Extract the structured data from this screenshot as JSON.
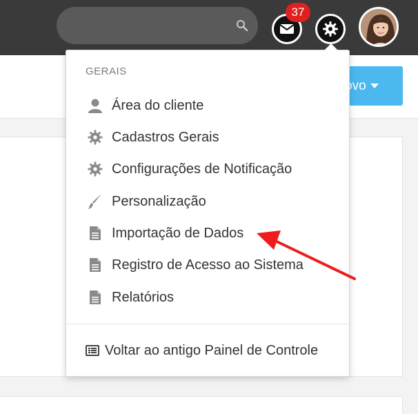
{
  "topbar": {
    "search": {
      "placeholder": ""
    },
    "mail": {
      "icon": "mail-icon",
      "unread_count": "37"
    },
    "settings": {
      "icon": "gear-icon"
    },
    "avatar": {
      "icon": "user-avatar"
    }
  },
  "page": {
    "new_button_label": "ovo"
  },
  "dropdown": {
    "section_label": "GERAIS",
    "items": [
      {
        "label": "Área do cliente",
        "icon": "user-icon"
      },
      {
        "label": "Cadastros Gerais",
        "icon": "gear-icon"
      },
      {
        "label": "Configurações de Notificação",
        "icon": "gear-icon"
      },
      {
        "label": "Personalização",
        "icon": "brush-icon"
      },
      {
        "label": "Importação de Dados",
        "icon": "document-icon"
      },
      {
        "label": "Registro de Acesso ao Sistema",
        "icon": "document-icon"
      },
      {
        "label": "Relatórios",
        "icon": "document-icon"
      }
    ],
    "footer_label": "Voltar ao antigo Painel de Controle",
    "footer_icon": "panel-icon"
  },
  "colors": {
    "topbar": "#3a3a3a",
    "badge": "#e0201f",
    "accent": "#4cb8f0",
    "annotation_arrow": "#ee1c1c"
  }
}
